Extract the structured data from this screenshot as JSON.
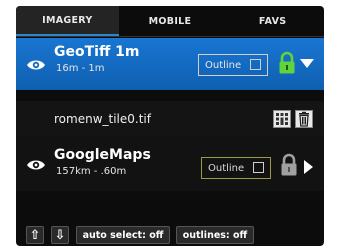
{
  "tabs": [
    {
      "label": "IMAGERY",
      "active": true
    },
    {
      "label": "MOBILE",
      "active": false
    },
    {
      "label": "FAVS",
      "active": false
    }
  ],
  "layers": [
    {
      "name": "GeoTiff 1m",
      "range": "16m - 1m",
      "outline_label": "Outline",
      "outline_checked": false,
      "locked": true,
      "expanded": true,
      "selected": true
    },
    {
      "name": "GoogleMaps",
      "range": "157km - .60m",
      "outline_label": "Outline",
      "outline_checked": false,
      "locked": true,
      "expanded": false,
      "selected": false
    }
  ],
  "sub_item": {
    "filename": "romenw_tile0.tif"
  },
  "bottom_bar": {
    "up_label": "⇧",
    "down_label": "⇩",
    "auto_select": "auto select: off",
    "outlines": "outlines: off"
  },
  "colors": {
    "accent": "#1976d2",
    "lock_green": "#5fd43c",
    "lock_gray": "#a0a0a0",
    "panel_bg": "#0c0c0c"
  },
  "icons": [
    "eye-icon",
    "lock-icon",
    "chevron-down-icon",
    "chevron-right-icon",
    "grid-icon",
    "trash-icon",
    "arrow-up-icon",
    "arrow-down-icon"
  ]
}
